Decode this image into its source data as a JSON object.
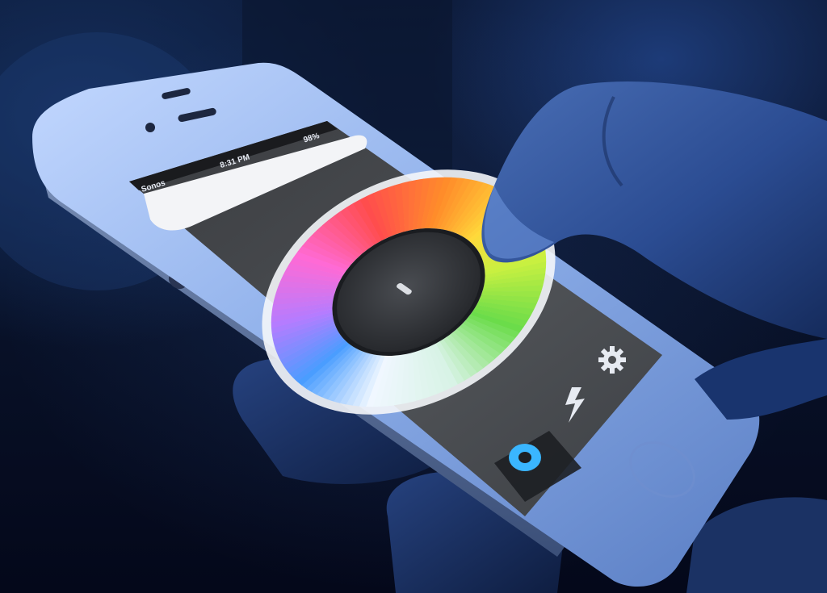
{
  "scene": {
    "description_type": "photo",
    "subject": "hand-held smartphone running a color-wheel lighting app"
  },
  "phone": {
    "status_bar": {
      "carrier": "Sonos",
      "time": "8:31 PM",
      "battery": "98%"
    },
    "app": {
      "wheel": {
        "colors": [
          "#ff4d4d",
          "#ff8c2a",
          "#ffd93a",
          "#c8f040",
          "#6bdc4a",
          "#d8f3e6",
          "#f0f7ff",
          "#4a9dff",
          "#b57cff",
          "#ff6ad5"
        ],
        "center_color": "#3a3d42"
      },
      "controls": [
        {
          "icon": "gear-icon",
          "label": ""
        },
        {
          "icon": "lightning-icon",
          "label": ""
        },
        {
          "icon": "bulb-ring-icon",
          "label": ""
        }
      ]
    }
  },
  "colors": {
    "accent": "#3ab6ff",
    "screen_bg": "#4d4f53",
    "phone_body": "#9db8e6"
  }
}
